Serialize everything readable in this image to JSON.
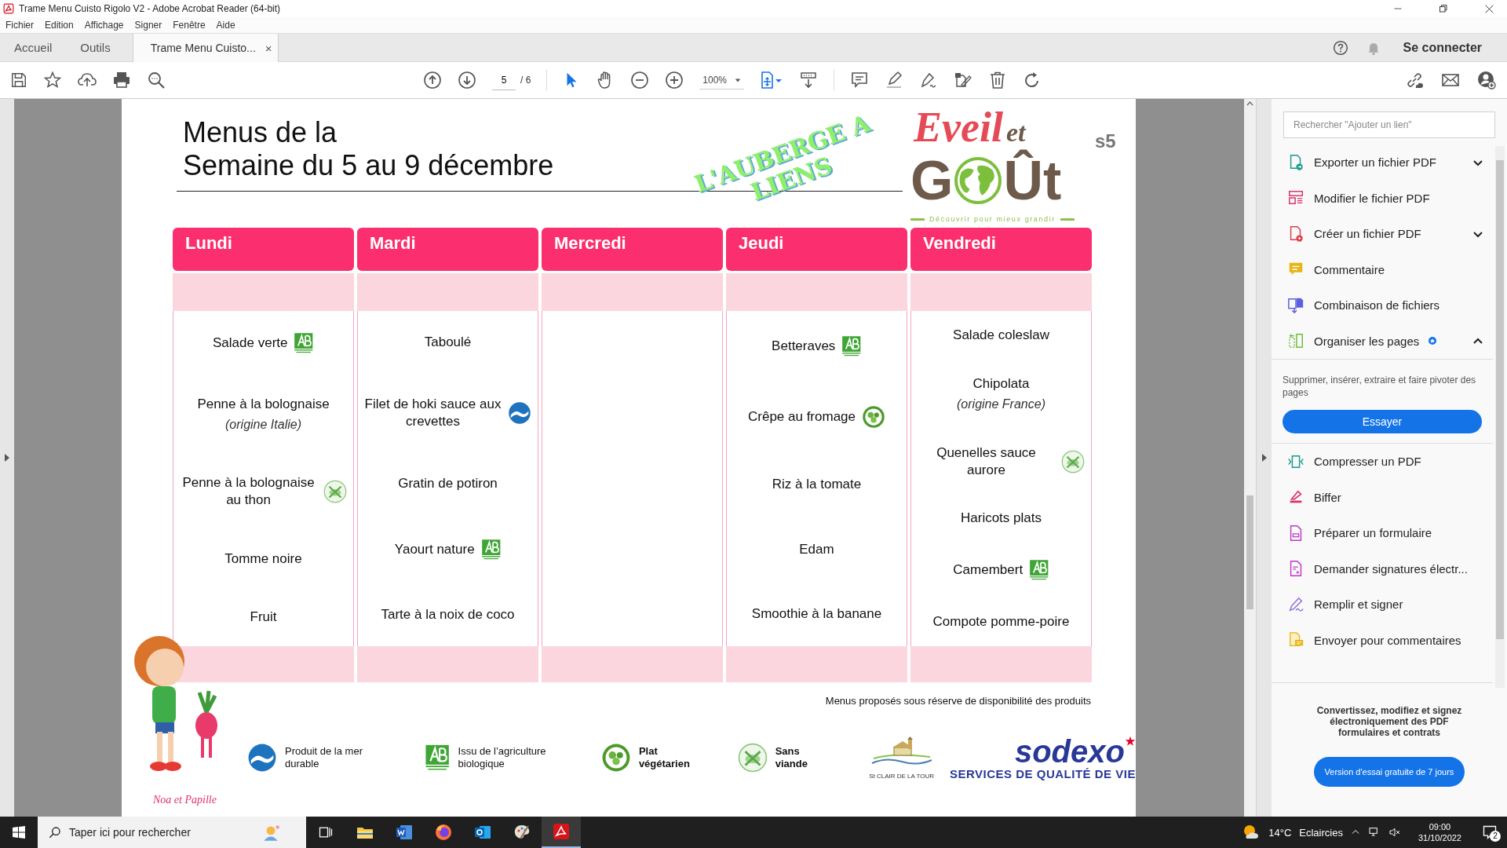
{
  "window": {
    "title": "Trame Menu Cuisto Rigolo V2 - Adobe Acrobat Reader (64-bit)"
  },
  "menu": [
    "Fichier",
    "Edition",
    "Affichage",
    "Signer",
    "Fenêtre",
    "Aide"
  ],
  "tabs": [
    {
      "label": "Accueil",
      "selected": false,
      "kind": "nav"
    },
    {
      "label": "Outils",
      "selected": false,
      "kind": "nav"
    },
    {
      "label": "Trame Menu Cuisto...",
      "selected": true,
      "kind": "document",
      "close": "×"
    }
  ],
  "account": {
    "label": "Se connecter"
  },
  "toolbar": {
    "page": "5",
    "page_total": "/ 6",
    "zoom": "100%"
  },
  "document": {
    "title_lines": [
      "Menus de la",
      "Semaine du 5 au 9 décembre"
    ],
    "wordart_lines": [
      "L'AUBERGE A",
      "LIENS"
    ],
    "logo": {
      "script": "Eveil",
      "script_small": "et",
      "word_start": "G",
      "word_end": "Ût",
      "tagline": "Découvrir pour mieux grandir"
    },
    "week_code": "s5",
    "days": [
      {
        "name": "Lundi",
        "dishes": [
          {
            "name": "Salade verte",
            "kind": "bio"
          },
          {
            "name": "Penne à la bolognaise",
            "origin": "(origine Italie)",
            "kind": "plain"
          },
          {
            "name": "Penne à la bolognaise au thon",
            "kind": "sans_viande"
          },
          {
            "name": "Tomme noire",
            "kind": "plain"
          },
          {
            "name": "Fruit",
            "kind": "plain"
          }
        ]
      },
      {
        "name": "Mardi",
        "dishes": [
          {
            "name": "Taboulé",
            "kind": "plain"
          },
          {
            "name": "Filet de hoki sauce aux crevettes",
            "kind": "mer"
          },
          {
            "name": "Gratin de potiron",
            "kind": "plain"
          },
          {
            "name": "Yaourt nature",
            "kind": "bio"
          },
          {
            "name": "Tarte à la noix de coco",
            "kind": "plain"
          }
        ]
      },
      {
        "name": "Mercredi"
      },
      {
        "name": "Jeudi",
        "dishes": [
          {
            "name": "Betteraves",
            "kind": "bio"
          },
          {
            "name": "Crêpe au fromage",
            "kind": "vege"
          },
          {
            "name": "Riz à la tomate",
            "kind": "plain"
          },
          {
            "name": "Edam",
            "kind": "plain"
          },
          {
            "name": "Smoothie à la banane",
            "kind": "plain"
          }
        ]
      },
      {
        "name": "Vendredi",
        "dishes": [
          {
            "name": "Salade coleslaw",
            "kind": "plain"
          },
          {
            "name": "Chipolata",
            "origin": "(origine France)",
            "kind": "plain"
          },
          {
            "name": "Quenelles sauce aurore",
            "kind": "sans_viande"
          },
          {
            "name": "Haricots plats",
            "kind": "plain"
          },
          {
            "name": "Camembert",
            "kind": "bio"
          },
          {
            "name": "Compote pomme-poire",
            "kind": "plain"
          }
        ]
      }
    ],
    "note": "Menus proposés sous réserve de disponibilité des produits",
    "mascot_caption": "Noa et Papille",
    "legend": [
      {
        "kind": "mer",
        "text": "Produit de la mer durable"
      },
      {
        "kind": "bio",
        "text": "Issu de l’agriculture biologique"
      },
      {
        "kind": "vege",
        "text": "Plat végétarien"
      },
      {
        "kind": "sans_viande",
        "text": "Sans viande"
      }
    ],
    "town_logo": "St CLAIR DE LA TOUR",
    "sodexo": {
      "name": "sodexo",
      "tagline": "SERVICES DE QUALITÉ DE VIE"
    }
  },
  "tools_panel": {
    "search_placeholder": "Rechercher \"Ajouter un lien\"",
    "tools": [
      {
        "label": "Exporter un fichier PDF",
        "color": "#1b9a8f",
        "kind": "dropdown",
        "expanded": false,
        "new": false
      },
      {
        "label": "Modifier le fichier PDF",
        "color": "#d6336c",
        "kind": "tool",
        "new": false
      },
      {
        "label": "Créer un fichier PDF",
        "color": "#e03c4a",
        "kind": "dropdown",
        "expanded": false,
        "new": false
      },
      {
        "label": "Commentaire",
        "color": "#e8b416",
        "kind": "tool",
        "new": false
      },
      {
        "label": "Combinaison de fichiers",
        "color": "#5b5fe0",
        "kind": "tool",
        "new": false
      },
      {
        "label": "Organiser les pages",
        "color": "#6cbf3c",
        "kind": "dropdown",
        "expanded": true,
        "new": true,
        "description": "Supprimer, insérer, extraire et faire pivoter des pages",
        "action": "Essayer"
      },
      {
        "label": "Compresser un PDF",
        "color": "#1b9a8f",
        "kind": "tool",
        "new": false
      },
      {
        "label": "Biffer",
        "color": "#d6336c",
        "kind": "tool",
        "new": false
      },
      {
        "label": "Préparer un formulaire",
        "color": "#c03bc8",
        "kind": "tool",
        "new": false
      },
      {
        "label": "Demander signatures électr...",
        "color": "#c03bc8",
        "kind": "tool",
        "new": false
      },
      {
        "label": "Remplir et signer",
        "color": "#8f6bd8",
        "kind": "tool",
        "new": false
      },
      {
        "label": "Envoyer pour commentaires",
        "color": "#e8b416",
        "kind": "tool",
        "new": false
      }
    ],
    "promo": {
      "text": "Convertissez, modifiez et signez électroniquement des PDF formulaires et contrats",
      "button": "Version d'essai gratuite de 7 jours"
    }
  },
  "taskbar": {
    "search_placeholder": "Taper ici pour rechercher",
    "apps": [
      {
        "kind": "task_view",
        "selected": false
      },
      {
        "kind": "explorer",
        "selected": false
      },
      {
        "kind": "word",
        "selected": false
      },
      {
        "kind": "firefox",
        "selected": false
      },
      {
        "kind": "outlook",
        "selected": false
      },
      {
        "kind": "paint",
        "selected": false
      },
      {
        "kind": "acrobat",
        "selected": true
      }
    ],
    "temperature": "14°C",
    "weather": "Eclaircies",
    "time": "09:00",
    "date": "31/10/2022",
    "notifications": "2"
  }
}
